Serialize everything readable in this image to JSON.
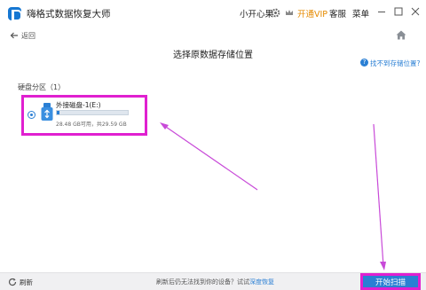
{
  "app": {
    "title": "嗨格式数据恢复大师"
  },
  "topbar": {
    "user_name": "小开心果",
    "vip_label": "开通VIP",
    "service_label": "客服",
    "menu_label": "菜单",
    "gear_icon": "gear-icon",
    "crown_icon": "crown-icon"
  },
  "subheader": {
    "back_label": "返回",
    "title": "选择原数据存储位置",
    "help_link": "找不到存储位置?"
  },
  "section": {
    "label": "硬盘分区（1）"
  },
  "disks": [
    {
      "name": "外接磁盘-1(E:)",
      "usage_fraction": 0.04,
      "size_text": "28.48 GB可用，共29.59 GB",
      "selected": true
    }
  ],
  "footer": {
    "refresh_label": "刷新",
    "hint_text": "刷新后仍无法找到你的设备？试试",
    "hint_link": "深度恢复",
    "scan_button": "开始扫描"
  },
  "colors": {
    "accent": "#2a7fd4",
    "vip": "#e58a00",
    "annotation": "#e020d0"
  }
}
